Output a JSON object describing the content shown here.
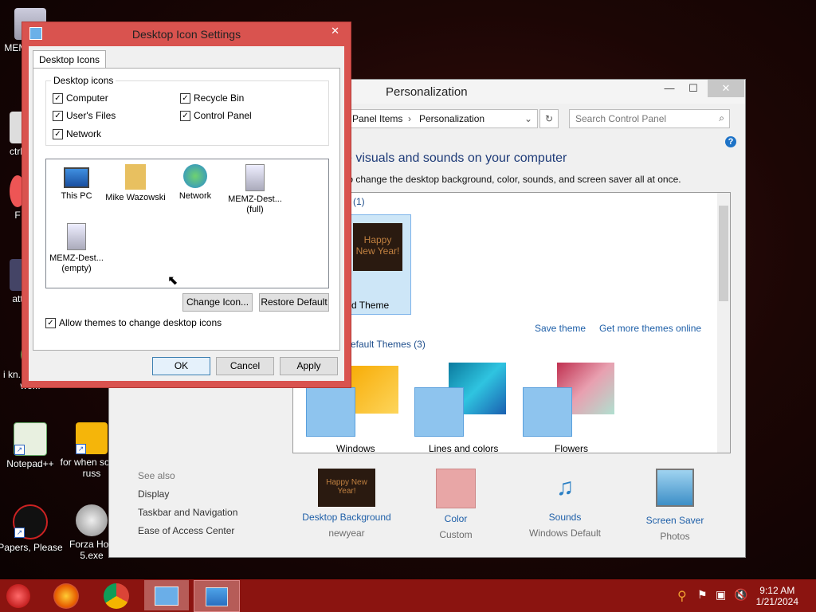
{
  "desktop_icons": [
    {
      "label": "MEMZ"
    },
    {
      "label": "ctrl-"
    },
    {
      "label": "F"
    },
    {
      "label": "att"
    },
    {
      "label": "i kn... people we..."
    },
    {
      "label": "Notepad++"
    },
    {
      "label": "for when some russ"
    },
    {
      "label": "Papers, Please"
    },
    {
      "label": "Forza Hori 5.exe"
    }
  ],
  "personalization": {
    "title": "Personalization",
    "breadcrumb": [
      "l Panel Items",
      "Personalization"
    ],
    "search_placeholder": "Search Control Panel",
    "heading": "e visuals and sounds on your computer",
    "subheading": "to change the desktop background, color, sounds, and screen saver all at once.",
    "my_themes_count": "(1)",
    "unsaved_theme_label": "d Theme",
    "save_theme": "Save theme",
    "get_more_themes": "Get more themes online",
    "default_themes_group": "efault Themes (3)",
    "themes": [
      {
        "name": "Windows"
      },
      {
        "name": "Lines and colors"
      },
      {
        "name": "Flowers"
      }
    ],
    "see_also": {
      "title": "See also",
      "links": [
        "Display",
        "Taskbar and Navigation",
        "Ease of Access Center"
      ]
    },
    "bottom": [
      {
        "label": "Desktop Background",
        "sub": "newyear"
      },
      {
        "label": "Color",
        "sub": "Custom"
      },
      {
        "label": "Sounds",
        "sub": "Windows Default"
      },
      {
        "label": "Screen Saver",
        "sub": "Photos"
      }
    ],
    "thumb_text": "Happy New Year!"
  },
  "dialog": {
    "title": "Desktop Icon Settings",
    "tab": "Desktop Icons",
    "group_label": "Desktop icons",
    "checkboxes": [
      {
        "label": "Computer",
        "checked": true
      },
      {
        "label": "Recycle Bin",
        "checked": true
      },
      {
        "label": "User's Files",
        "checked": true
      },
      {
        "label": "Control Panel",
        "checked": true
      },
      {
        "label": "Network",
        "checked": true
      }
    ],
    "icons": [
      {
        "label": "This PC"
      },
      {
        "label": "Mike Wazowski"
      },
      {
        "label": "Network"
      },
      {
        "label": "MEMZ-Dest... (full)"
      },
      {
        "label": "MEMZ-Dest... (empty)"
      }
    ],
    "change_icon": "Change Icon...",
    "restore_default": "Restore Default",
    "allow_themes": "Allow themes to change desktop icons",
    "ok": "OK",
    "cancel": "Cancel",
    "apply": "Apply"
  },
  "taskbar": {
    "time": "9:12 AM",
    "date": "1/21/2024"
  }
}
